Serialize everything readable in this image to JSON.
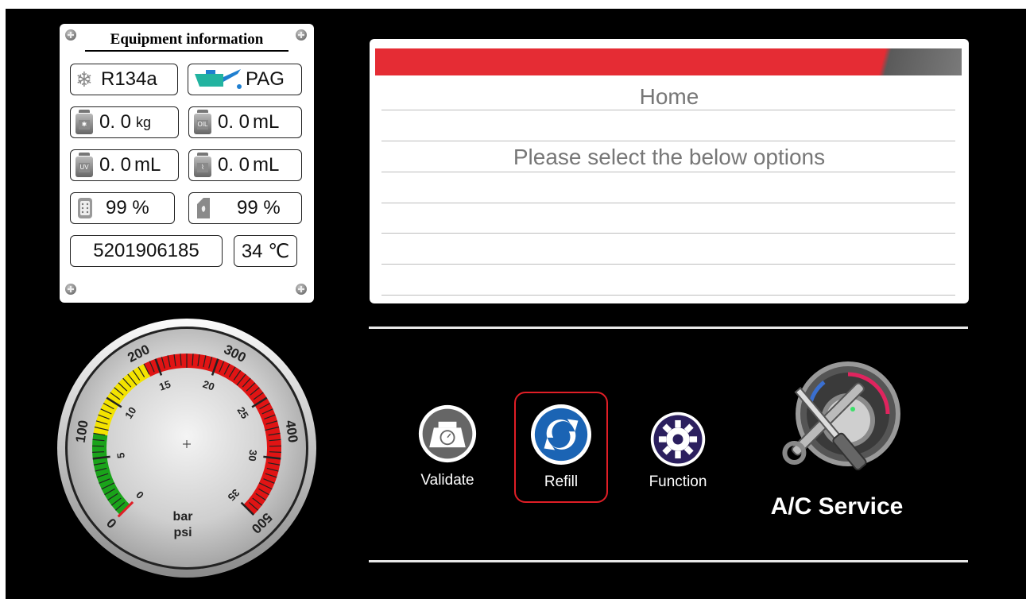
{
  "equipment_panel": {
    "title": "Equipment information",
    "refrigerant": "R134a",
    "oil_type": "PAG",
    "refrigerant_amount": {
      "value": "0. 0",
      "unit": "kg"
    },
    "oil_amount": {
      "value": "0. 0",
      "unit": "mL"
    },
    "uv_amount": {
      "value": "0. 0",
      "unit": "mL"
    },
    "waste_oil_amount": {
      "value": "0. 0",
      "unit": "mL"
    },
    "filter_percent": "99 %",
    "oil_bottle_percent": "99 %",
    "serial": "5201906185",
    "temperature": "34 ℃",
    "oil_icon_label": "OIL",
    "uv_icon_label": "UV"
  },
  "gauge": {
    "bar_ticks": [
      "0",
      "5",
      "10",
      "15",
      "20",
      "25",
      "30",
      "35"
    ],
    "psi_ticks": [
      "0",
      "100",
      "200",
      "300",
      "400",
      "500"
    ],
    "unit_bar": "bar",
    "unit_psi": "psi",
    "needle_value": 0
  },
  "message_panel": {
    "title": "Home",
    "message": "Please select the below options"
  },
  "buttons": {
    "validate": "Validate",
    "refill": "Refill",
    "function": "Function"
  },
  "app_label": "A/C Service",
  "colors": {
    "header_red": "#e52c34",
    "selection_red": "#e01e26",
    "refill_blue": "#1b64b4",
    "function_purple": "#2b1f5e"
  }
}
